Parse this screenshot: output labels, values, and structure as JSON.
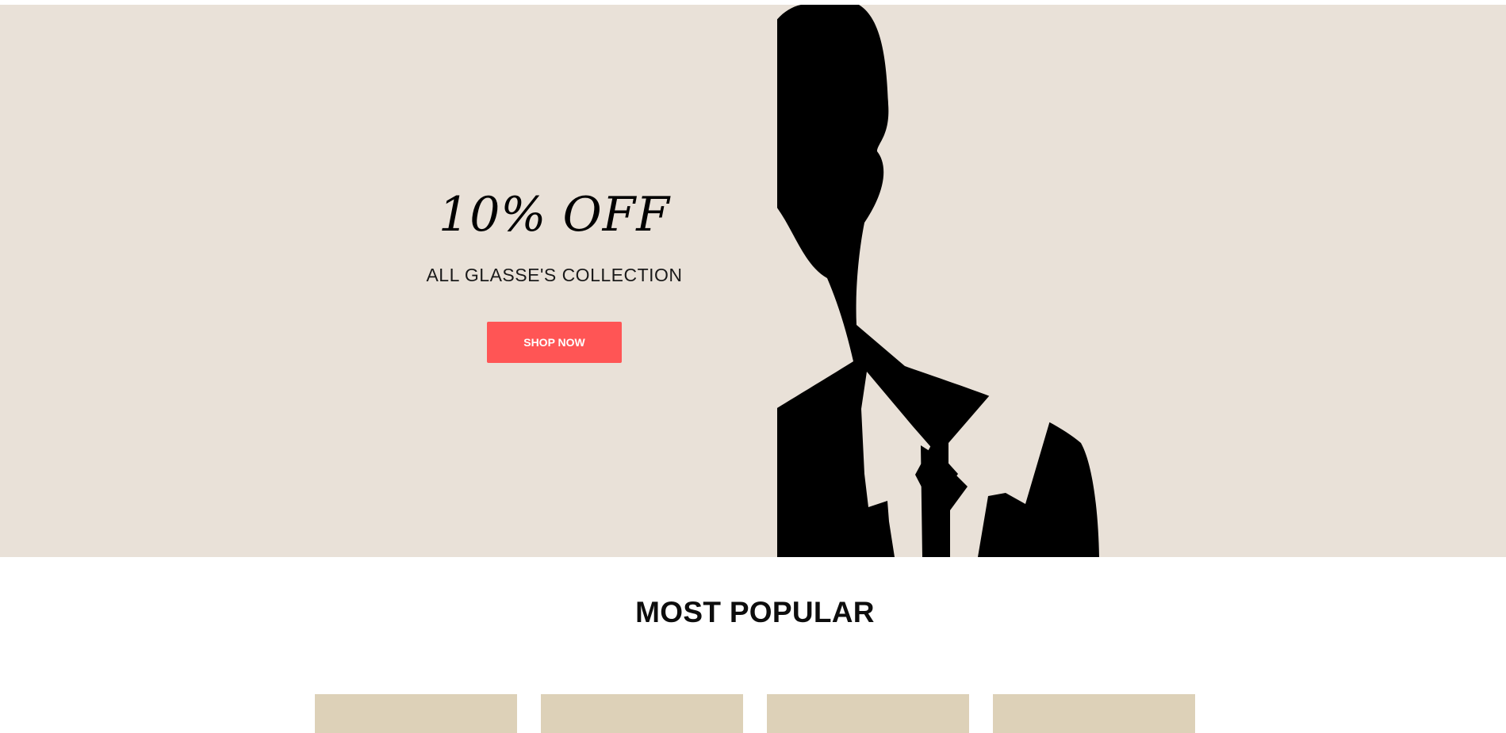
{
  "hero": {
    "promo_title": "10% OFF",
    "promo_subtitle": "ALL GLASSE'S COLLECTION",
    "cta_label": "SHOP NOW",
    "image_icon": "man-silhouette-icon",
    "background_color": "#e9e1d8",
    "cta_color": "#ff5555"
  },
  "most_popular": {
    "title": "MOST POPULAR",
    "products": [
      {
        "card_color": "#ddd1b8"
      },
      {
        "card_color": "#ddd1b8"
      },
      {
        "card_color": "#ddd1b8"
      },
      {
        "card_color": "#ddd1b8"
      }
    ]
  }
}
